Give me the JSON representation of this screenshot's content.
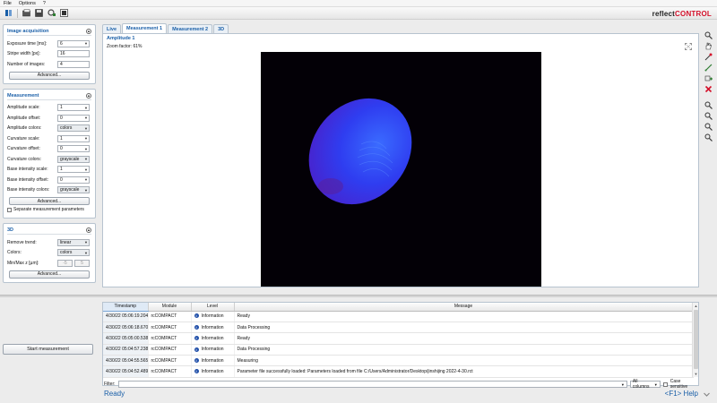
{
  "menu": [
    "File",
    "Options",
    "?"
  ],
  "brand": {
    "prefix": "reflect",
    "accent": "CONTROL"
  },
  "left": {
    "acquisition": {
      "title": "Image acquisition",
      "rows": [
        {
          "label": "Exposure time [ms]:",
          "value": "6"
        },
        {
          "label": "Stripe width [px]:",
          "value": "16"
        },
        {
          "label": "Number of images:",
          "value": "4"
        }
      ],
      "advanced": "Advanced..."
    },
    "measurement": {
      "title": "Measurement",
      "rows": [
        {
          "label": "Amplitude scale:",
          "value": "1"
        },
        {
          "label": "Amplitude offset:",
          "value": "0"
        },
        {
          "label": "Amplitude colors:",
          "value": "colors"
        },
        {
          "label": "Curvature scale:",
          "value": "1"
        },
        {
          "label": "Curvature offset:",
          "value": "0"
        },
        {
          "label": "Curvature colors:",
          "value": "grayscale"
        },
        {
          "label": "Base intensity scale:",
          "value": "1"
        },
        {
          "label": "Base intensity offset:",
          "value": "0"
        },
        {
          "label": "Base intensity colors:",
          "value": "grayscale"
        }
      ],
      "advanced": "Advanced...",
      "separate": "Separate measurement parameters"
    },
    "three_d": {
      "title": "3D",
      "rows": [
        {
          "label": "Remove trend:",
          "value": "linear"
        },
        {
          "label": "Colors:",
          "value": "colors"
        }
      ],
      "minmax_label": "Min/Max z [µm]:",
      "min": "-5",
      "max": "5",
      "advanced": "Advanced..."
    },
    "start": "Start measurement"
  },
  "tabs": [
    "Live",
    "Measurement 1",
    "Measurement 2",
    "3D"
  ],
  "view": {
    "title": "Amplitude 1",
    "zoom": "Zoom factor: 61%"
  },
  "log": {
    "columns": [
      "Timestamp",
      "Module",
      "Level",
      "Message"
    ],
    "rows": [
      {
        "ts": "4/30/22 05:06:19.204",
        "module": "rcCOMPACT",
        "level": "Information",
        "msg": "Ready"
      },
      {
        "ts": "4/30/22 05:06:18.670",
        "module": "rcCOMPACT",
        "level": "Information",
        "msg": "Data Processing"
      },
      {
        "ts": "4/30/22 05:05:00.538",
        "module": "rcCOMPACT",
        "level": "Information",
        "msg": "Ready"
      },
      {
        "ts": "4/30/22 05:04:57.238",
        "module": "rcCOMPACT",
        "level": "Information",
        "msg": "Data Processing"
      },
      {
        "ts": "4/30/22 05:04:55.565",
        "module": "rcCOMPACT",
        "level": "Information",
        "msg": "Measuring"
      },
      {
        "ts": "4/30/22 05:04:52.489",
        "module": "rcCOMPACT",
        "level": "Information",
        "msg": "Parameter file successfully loaded: Parameters loaded from file C:/Users/Administrator/Desktop/jinshijing 2022-4-30.rct"
      }
    ],
    "filter_label": "Filter:",
    "filter_value": "",
    "filter_scope": "All columns",
    "case_sensitive": "Case sensitive"
  },
  "status": {
    "ready": "Ready",
    "help": "<F1> Help"
  },
  "colors": {
    "accent_blue": "#1a5fa8",
    "brand_red": "#d4102a",
    "info_blue": "#1f4ea8"
  }
}
